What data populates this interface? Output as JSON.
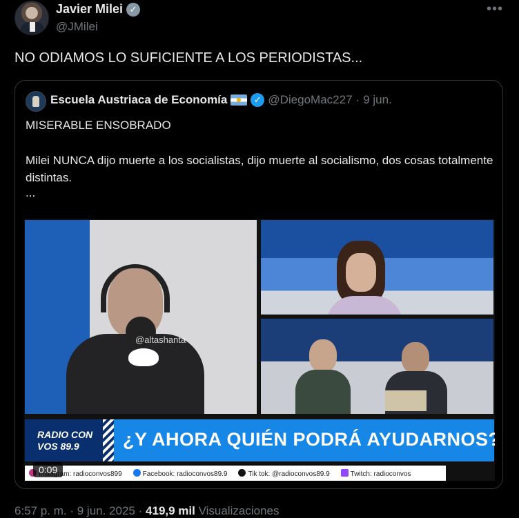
{
  "author": {
    "name": "Javier Milei",
    "handle": "@JMilei"
  },
  "tweet": {
    "text": "NO ODIAMOS LO SUFICIENTE A LOS PERIODISTAS...",
    "more_icon": "more-icon"
  },
  "quote": {
    "name": "Escuela Austriaca de Economía",
    "handle": "@DiegoMac227",
    "separator": "·",
    "date": "9 jun.",
    "line1": "MISERABLE ENSOBRADO",
    "line2": "Milei NUNCA dijo muerte a los socialistas, dijo muerte al socialismo, dos cosas totalmente distintas.",
    "line3": "..."
  },
  "video": {
    "watermark": "@altashanta",
    "banner_logo_line1": "RADIO CON",
    "banner_logo_line2": "VOS 89.9",
    "banner_text": "¿Y AHORA QUIÉN PODRÁ AYUDARNOS?",
    "socials": [
      {
        "label": "Instagram: radioconvos899"
      },
      {
        "label": "Facebook: radioconvos89.9"
      },
      {
        "label": "Tik tok: @radioconvos89.9"
      },
      {
        "label": "Twitch: radioconvos"
      }
    ],
    "duration": "0:09"
  },
  "footer": {
    "time": "6:57 p. m.",
    "sep1": "·",
    "date": "9 jun. 2025",
    "sep2": "·",
    "views": "419,9 mil",
    "views_label": "Visualizaciones"
  }
}
